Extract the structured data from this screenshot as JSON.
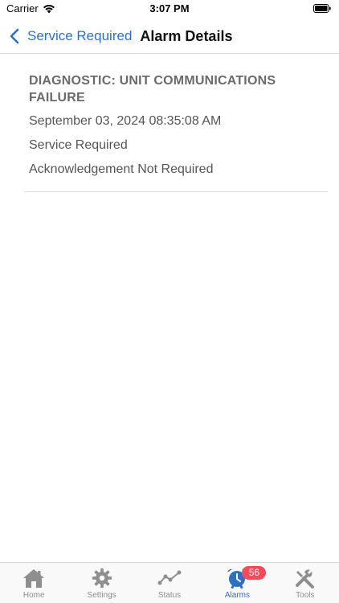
{
  "status_bar": {
    "carrier": "Carrier",
    "time": "3:07 PM"
  },
  "nav": {
    "back_label": "Service Required",
    "title": "Alarm Details"
  },
  "alarm": {
    "title": "DIAGNOSTIC: UNIT COMMUNICATIONS FAILURE",
    "timestamp": "September 03, 2024 08:35:08 AM",
    "category": "Service Required",
    "acknowledgement": "Acknowledgement Not Required"
  },
  "tabs": [
    {
      "label": "Home",
      "icon": "home-icon"
    },
    {
      "label": "Settings",
      "icon": "gear-icon"
    },
    {
      "label": "Status",
      "icon": "trend-icon"
    },
    {
      "label": "Alarms",
      "icon": "alarm-clock-icon",
      "badge": "56",
      "active": true
    },
    {
      "label": "Tools",
      "icon": "tools-icon"
    }
  ],
  "colors": {
    "accent": "#2f6fc4",
    "inactive": "#8e8e8e",
    "badge": "#ef4d5c"
  }
}
